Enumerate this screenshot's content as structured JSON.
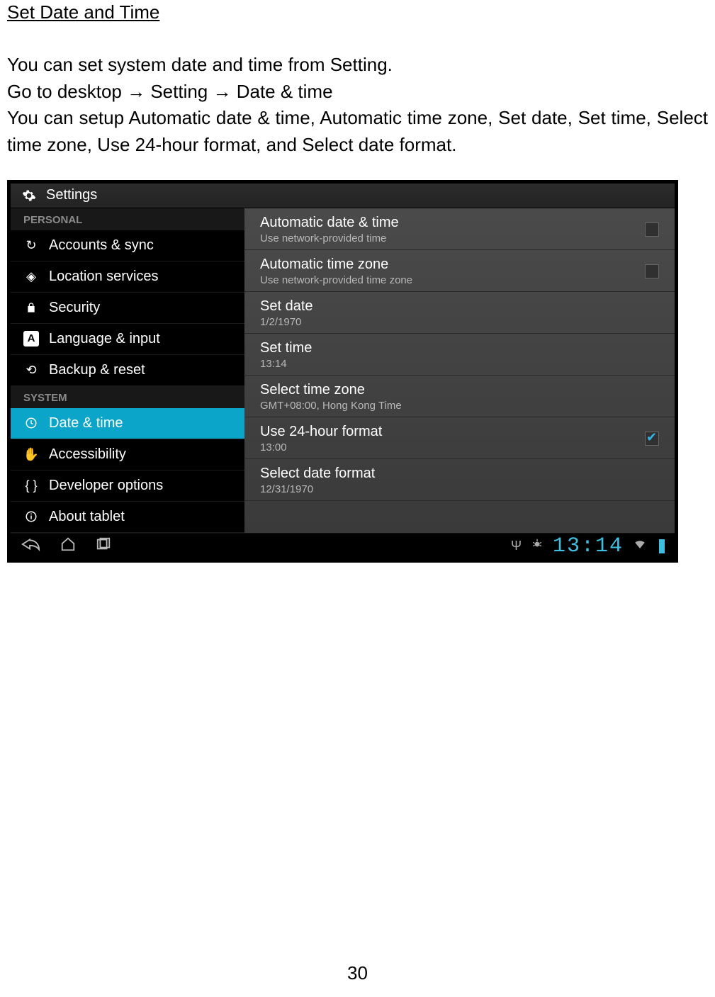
{
  "doc": {
    "section_title": "Set Date and Time",
    "para1": "You can set system date and time from Setting.",
    "para2": "Go to desktop → Setting → Date & time",
    "para3": "You can setup Automatic date & time, Automatic time zone, Set date, Set time, Select time zone, Use 24-hour format, and Select date format.",
    "page_number": "30"
  },
  "screenshot": {
    "app_title": "Settings",
    "sidebar": {
      "header_personal": "PERSONAL",
      "header_system": "SYSTEM",
      "items_personal": [
        "Accounts & sync",
        "Location services",
        "Security",
        "Language & input",
        "Backup & reset"
      ],
      "items_system": [
        "Date & time",
        "Accessibility",
        "Developer options",
        "About tablet"
      ]
    },
    "detail": [
      {
        "title": "Automatic date & time",
        "sub": "Use network-provided time",
        "check": "unchecked"
      },
      {
        "title": "Automatic time zone",
        "sub": "Use network-provided time zone",
        "check": "unchecked"
      },
      {
        "title": "Set date",
        "sub": "1/2/1970"
      },
      {
        "title": "Set time",
        "sub": "13:14"
      },
      {
        "title": "Select time zone",
        "sub": "GMT+08:00, Hong Kong Time"
      },
      {
        "title": "Use 24-hour format",
        "sub": "13:00",
        "check": "checked"
      },
      {
        "title": "Select date format",
        "sub": "12/31/1970"
      }
    ],
    "navbar_clock": "13:14"
  }
}
